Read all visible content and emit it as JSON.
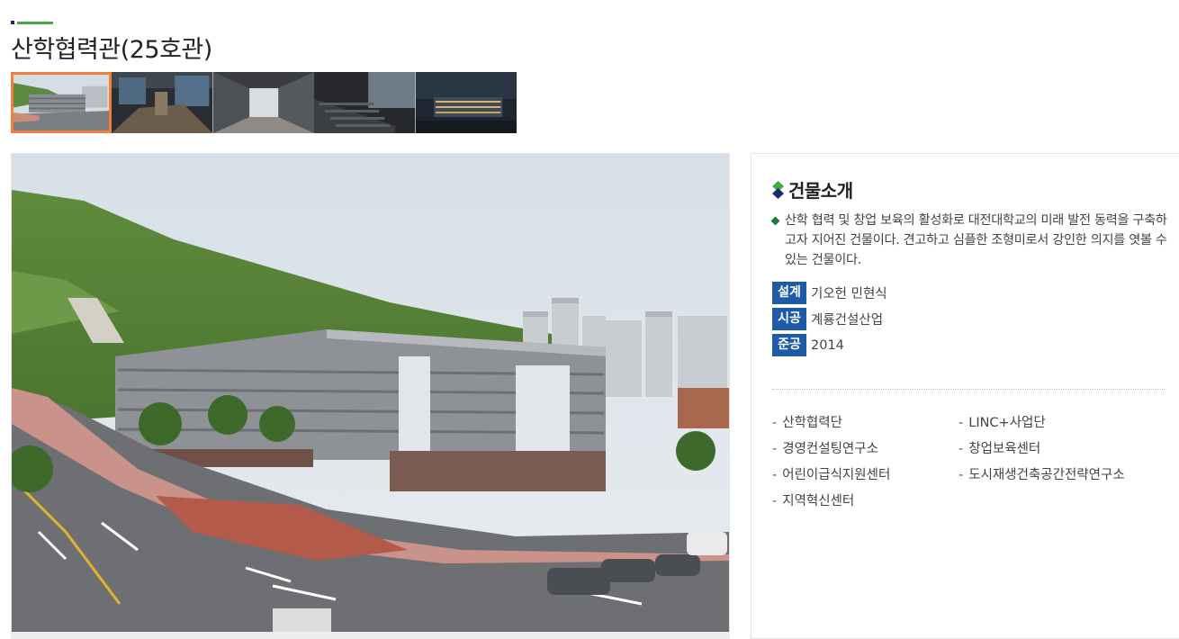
{
  "page": {
    "title": "산학협력관(25호관)",
    "colors": {
      "accent_green": "#46a948",
      "accent_navy": "#1c2a6b",
      "active_thumb_border": "#f08040",
      "label_bg": "#1f5aa8"
    }
  },
  "gallery": {
    "thumbnails": [
      {
        "name": "building-exterior-thumbnail",
        "active": true
      },
      {
        "name": "interior-lobby-thumbnail",
        "active": false
      },
      {
        "name": "courtyard-thumbnail",
        "active": false
      },
      {
        "name": "lecture-hall-thumbnail",
        "active": false
      },
      {
        "name": "night-view-thumbnail",
        "active": false
      }
    ],
    "main_image": "building-exterior-photo"
  },
  "info": {
    "heading": "건물소개",
    "description": "산학 협력 및 창업 보육의 활성화로 대전대학교의 미래 발전 동력을 구축하고자 지어진 건물이다. 견고하고 심플한 조형미로서 강인한 의지를 엿볼 수 있는 건물이다.",
    "specs": [
      {
        "label": "설계",
        "value": "기오헌 민현식"
      },
      {
        "label": "시공",
        "value": "계룡건설산업"
      },
      {
        "label": "준공",
        "value": "2014"
      }
    ],
    "organizations": [
      "산학협력단",
      "LINC+사업단",
      "경영컨설팅연구소",
      "창업보육센터",
      "어린이급식지원센터",
      "도시재생건축공간전략연구소",
      "지역혁신센터"
    ]
  }
}
